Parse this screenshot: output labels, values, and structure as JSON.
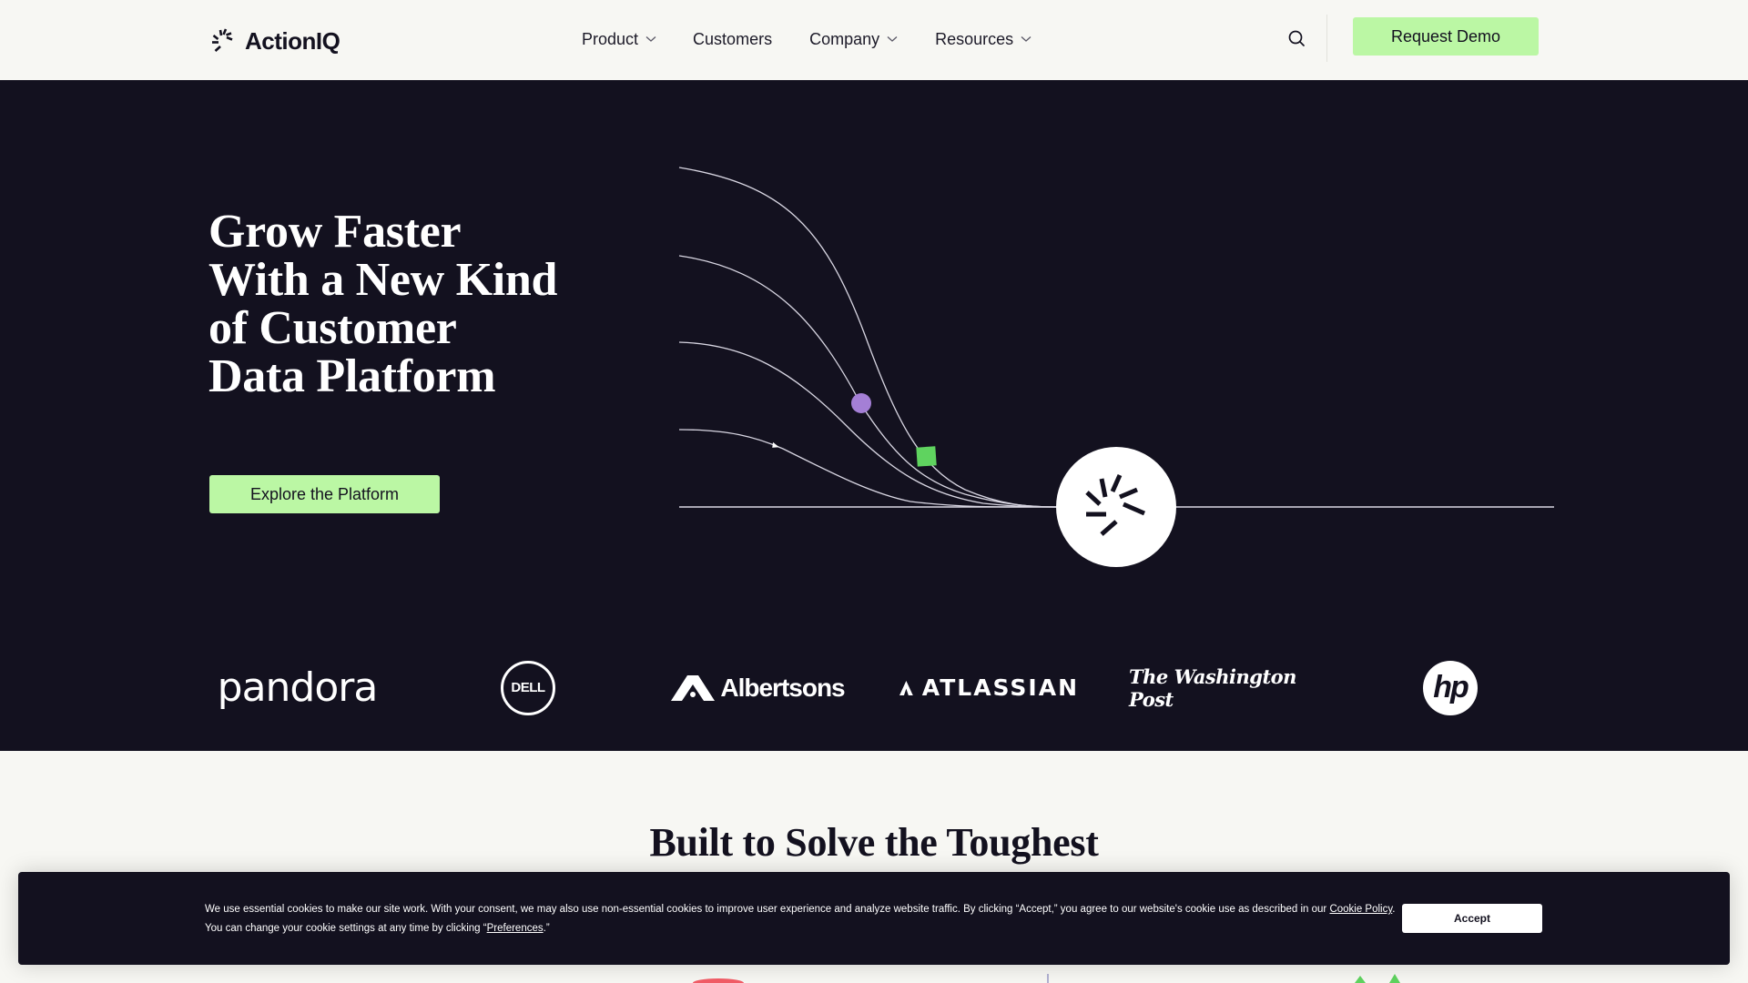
{
  "header": {
    "logo_text": "ActionIQ",
    "logo_icon": "burst-icon",
    "nav": [
      {
        "label": "Product",
        "has_dropdown": true
      },
      {
        "label": "Customers",
        "has_dropdown": false
      },
      {
        "label": "Company",
        "has_dropdown": true
      },
      {
        "label": "Resources",
        "has_dropdown": true
      }
    ],
    "search_icon": "search-icon",
    "cta_label": "Request Demo"
  },
  "hero": {
    "title_lines": [
      "Grow Faster",
      "With a New Kind",
      "of Customer",
      "Data Platform"
    ],
    "cta_label": "Explore the Platform",
    "graphic": {
      "curve_count": 4,
      "markers": [
        {
          "shape": "circle",
          "color": "#a47fd6"
        },
        {
          "shape": "square",
          "color": "#5fd35f"
        },
        {
          "shape": "arrow",
          "color": "#ffffff"
        }
      ],
      "hub_icon": "burst-icon"
    }
  },
  "customer_logos": [
    {
      "name": "pandora",
      "label": "pandora"
    },
    {
      "name": "dell",
      "label": "DELL"
    },
    {
      "name": "albertsons",
      "label": "Albertsons"
    },
    {
      "name": "atlassian",
      "label": "ATLASSIAN"
    },
    {
      "name": "washington-post",
      "label": "The Washington Post"
    },
    {
      "name": "hp",
      "label": "hp"
    }
  ],
  "section": {
    "title": "Built to Solve the Toughest"
  },
  "cookie_banner": {
    "text_main": "We use essential cookies to make our site work. With your consent, we may also use non-essential cookies to improve user experience and analyze website traffic. By clicking “Accept,” you agree to our website's cookie use as described in our ",
    "policy_link": "Cookie Policy",
    "text_after_link": ". You can change your cookie settings at any time by clicking “",
    "preferences_link": "Preferences",
    "text_end": ".”",
    "accept_label": "Accept"
  },
  "colors": {
    "page_bg": "#f7f7f3",
    "hero_bg": "#13111f",
    "accent_green": "#bbf7a4",
    "marker_purple": "#a47fd6",
    "marker_green": "#5fd35f"
  }
}
